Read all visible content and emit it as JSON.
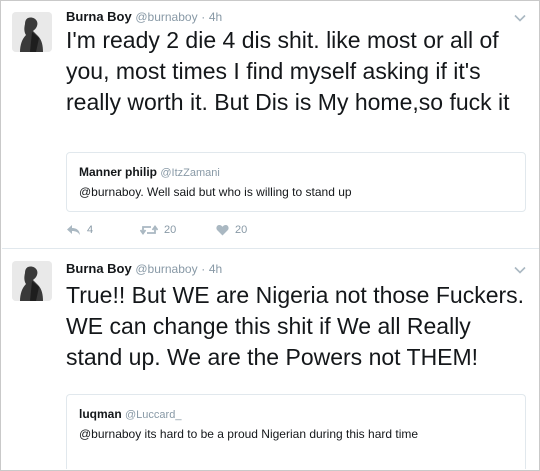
{
  "tweets": [
    {
      "author_name": "Burna Boy",
      "handle": "@burnaboy",
      "separator": "·",
      "time": "4h",
      "text": "I'm ready 2 die 4 dis shit. like most or all of you, most times I find myself asking if it's really worth it. But Dis is My home,so fuck it",
      "quote": {
        "author_name": "Manner philip",
        "handle": "@ItzZamani",
        "text": "@burnaboy. Well said but who is willing to stand up"
      },
      "actions": {
        "reply_count": "4",
        "retweet_count": "20",
        "like_count": "20"
      }
    },
    {
      "author_name": "Burna Boy",
      "handle": "@burnaboy",
      "separator": "·",
      "time": "4h",
      "text": "True!! But WE are Nigeria not those Fuckers. WE can change this shit if We all Really stand up. We are the Powers not THEM!",
      "quote": {
        "author_name": "luqman",
        "handle": "@Luccard_",
        "text": "@burnaboy its hard to be a proud Nigerian during this hard time"
      }
    }
  ],
  "icons": {
    "reply": "reply-icon",
    "retweet": "retweet-icon",
    "like": "heart-icon",
    "more": "chevron-down-icon"
  },
  "colors": {
    "text": "#14171a",
    "muted": "#8899a6",
    "border": "#e1e8ed",
    "icon": "#aab8c2"
  }
}
